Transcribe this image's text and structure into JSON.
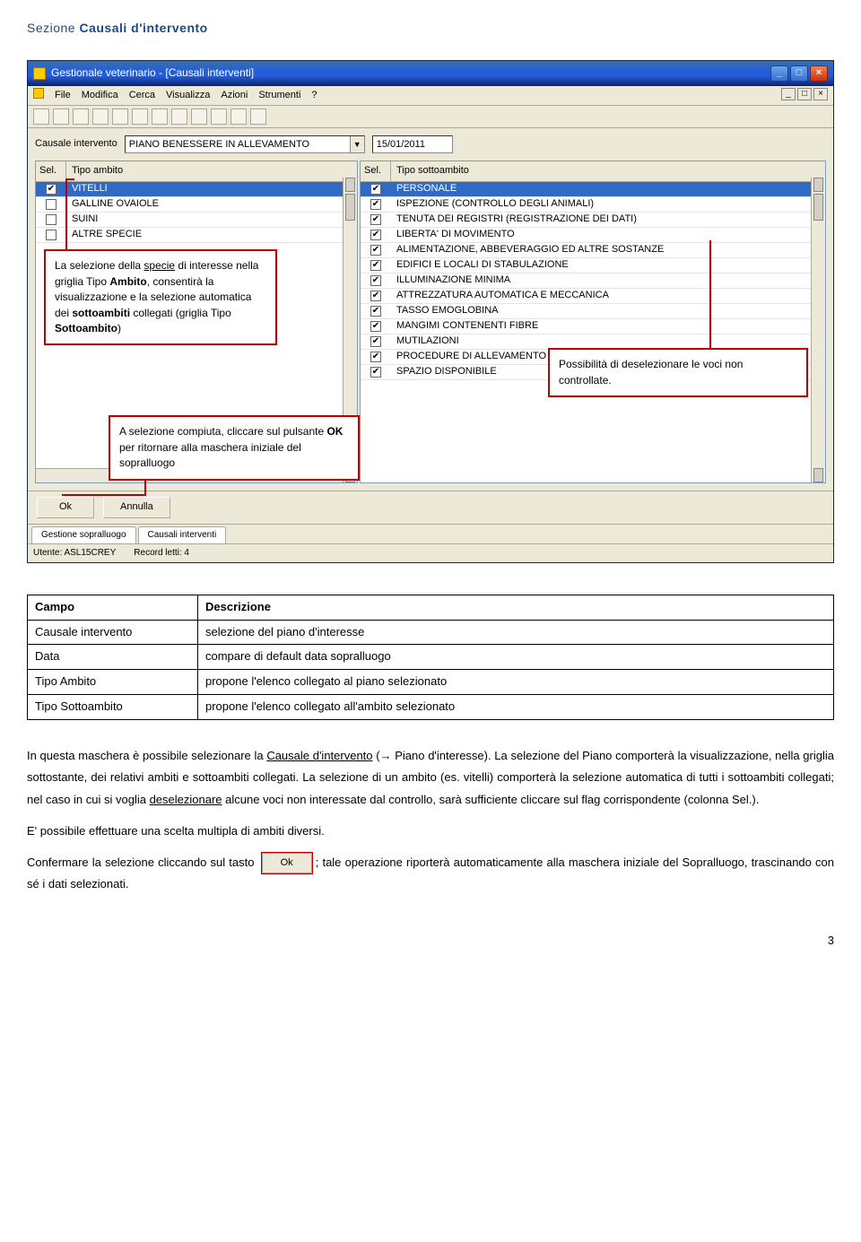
{
  "section_title_norm": "Sezione ",
  "section_title_bold": "Causali d'intervento",
  "window": {
    "title": "Gestionale veterinario - [Causali interventi]",
    "menus": [
      "File",
      "Modifica",
      "Cerca",
      "Visualizza",
      "Azioni",
      "Strumenti",
      "?"
    ],
    "causale_label": "Causale intervento",
    "causale_value": "PIANO BENESSERE IN ALLEVAMENTO",
    "date_value": "15/01/2011",
    "ambito_header_sel": "Sel.",
    "ambito_header_name": "Tipo ambito",
    "ambito_rows": [
      {
        "checked": true,
        "label": "VITELLI",
        "selected": true
      },
      {
        "checked": false,
        "label": "GALLINE OVAIOLE",
        "selected": false
      },
      {
        "checked": false,
        "label": "SUINI",
        "selected": false
      },
      {
        "checked": false,
        "label": "ALTRE SPECIE",
        "selected": false
      }
    ],
    "sotto_header_sel": "Sel.",
    "sotto_header_name": "Tipo sottoambito",
    "sotto_rows": [
      {
        "checked": true,
        "label": "PERSONALE",
        "selected": true
      },
      {
        "checked": true,
        "label": "ISPEZIONE (CONTROLLO DEGLI ANIMALI)",
        "selected": false
      },
      {
        "checked": true,
        "label": "TENUTA DEI REGISTRI (REGISTRAZIONE DEI DATI)",
        "selected": false
      },
      {
        "checked": true,
        "label": "LIBERTA' DI MOVIMENTO",
        "selected": false
      },
      {
        "checked": true,
        "label": "ALIMENTAZIONE, ABBEVERAGGIO ED ALTRE SOSTANZE",
        "selected": false
      },
      {
        "checked": true,
        "label": "EDIFICI E LOCALI DI STABULAZIONE",
        "selected": false
      },
      {
        "checked": true,
        "label": "ILLUMINAZIONE MINIMA",
        "selected": false
      },
      {
        "checked": true,
        "label": "ATTREZZATURA AUTOMATICA E MECCANICA",
        "selected": false
      },
      {
        "checked": true,
        "label": "TASSO EMOGLOBINA",
        "selected": false
      },
      {
        "checked": true,
        "label": "MANGIMI CONTENENTI FIBRE",
        "selected": false
      },
      {
        "checked": true,
        "label": "MUTILAZIONI",
        "selected": false
      },
      {
        "checked": true,
        "label": "PROCEDURE DI ALLEVAMENTO",
        "selected": false
      },
      {
        "checked": true,
        "label": "SPAZIO DISPONIBILE",
        "selected": false
      }
    ],
    "ok_label": "Ok",
    "cancel_label": "Annulla",
    "tabs": [
      "Gestione sopralluogo",
      "Causali interventi"
    ],
    "status_user_lbl": "Utente: ",
    "status_user_val": "ASL15CREY",
    "status_records_lbl": "Record letti: ",
    "status_records_val": "4"
  },
  "callouts": {
    "left_1": "La selezione della ",
    "left_u1": "specie",
    "left_2": " di interesse nella griglia Tipo ",
    "left_b1": "Ambito",
    "left_3": ", consentirà la visualizzazione e la selezione automatica dei ",
    "left_b2": "sottoambiti",
    "left_4": " collegati (griglia Tipo ",
    "left_b3": "Sottoambito",
    "left_5": ")",
    "mid_1": "A selezione compiuta, cliccare sul pulsante ",
    "mid_b1": "OK",
    "mid_2": " per ritornare alla maschera iniziale del sopralluogo",
    "right": "Possibilità di deselezionare le voci non controllate."
  },
  "defs": {
    "h1": "Campo",
    "h2": "Descrizione",
    "rows": [
      {
        "k": "Causale intervento",
        "v": "selezione del piano d'interesse"
      },
      {
        "k": "Data",
        "v": "compare di default data sopralluogo"
      },
      {
        "k": "Tipo Ambito",
        "v": "propone l'elenco collegato al piano selezionato"
      },
      {
        "k": "Tipo Sottoambito",
        "v": "propone l'elenco collegato all'ambito selezionato"
      }
    ]
  },
  "para": {
    "p1a": "In questa maschera è possibile selezionare la ",
    "p1u": "Causale d'intervento",
    "p1b": " (→ Piano d'interesse). La selezione del Piano comporterà la visualizzazione, nella griglia sottostante, dei relativi ambiti e sottoambiti collegati. La selezione di un ambito (es. vitelli) comporterà la selezione automatica di tutti i sottoambiti collegati; nel caso in cui si voglia ",
    "p1u2": "deselezionare",
    "p1c": " alcune voci non interessate dal controllo, sarà sufficiente cliccare sul flag corrispondente (colonna Sel.).",
    "p2": "E' possibile effettuare una scelta multipla di ambiti diversi.",
    "p3a": "Confermare la selezione cliccando sul tasto ",
    "p3b": "; tale operazione riporterà automaticamente alla maschera iniziale del Sopralluogo, trascinando con sé i dati selezionati.",
    "okbtn": "Ok"
  },
  "pagenum": "3"
}
